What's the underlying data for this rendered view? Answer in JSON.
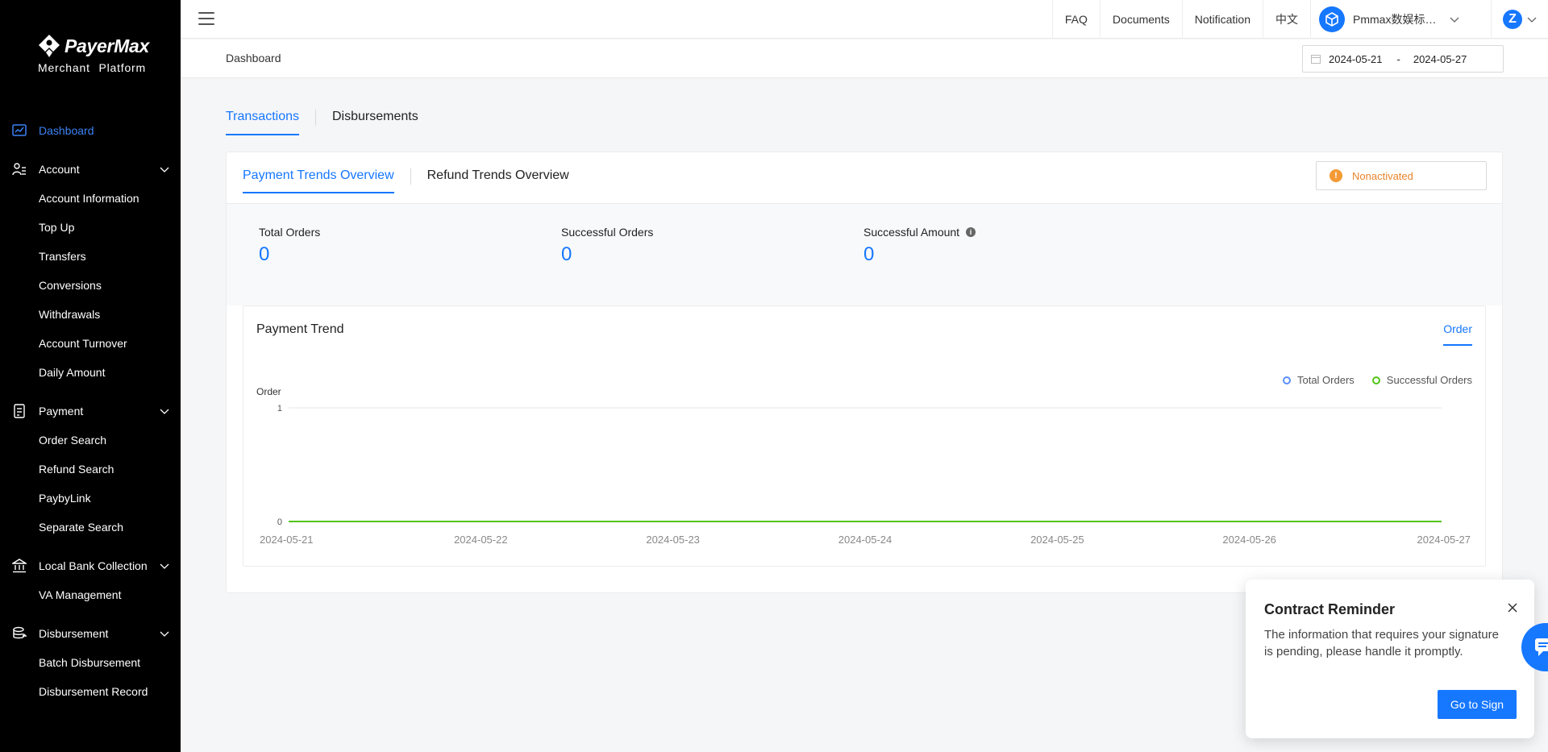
{
  "sidebar": {
    "logo_text": "PayerMax",
    "logo_subtext": "Merchant Platform",
    "dashboard": "Dashboard",
    "groups": [
      {
        "label": "Account",
        "items": [
          "Account Information",
          "Top Up",
          "Transfers",
          "Conversions",
          "Withdrawals",
          "Account Turnover",
          "Daily Amount"
        ]
      },
      {
        "label": "Payment",
        "items": [
          "Order Search",
          "Refund Search",
          "PaybyLink",
          "Separate Search"
        ]
      },
      {
        "label": "Local Bank Collection",
        "items": [
          "VA Management"
        ]
      },
      {
        "label": "Disbursement",
        "items": [
          "Batch Disbursement",
          "Disbursement Record"
        ]
      }
    ]
  },
  "header": {
    "links": [
      "FAQ",
      "Documents",
      "Notification",
      "中文"
    ],
    "merchant_name": "Pmmax数娱标准化测试商户",
    "avatar_letter": "Z"
  },
  "breadcrumb": "Dashboard",
  "date_range": {
    "start": "2024-05-21",
    "separator": "-",
    "end": "2024-05-27"
  },
  "main_tabs": [
    "Transactions",
    "Disbursements"
  ],
  "sub_tabs": [
    "Payment Trends Overview",
    "Refund Trends Overview"
  ],
  "status": "Nonactivated",
  "stats": [
    {
      "label": "Total Orders",
      "value": "0"
    },
    {
      "label": "Successful Orders",
      "value": "0"
    },
    {
      "label": "Successful Amount",
      "value": "0"
    }
  ],
  "trend": {
    "title": "Payment Trend",
    "tab": "Order"
  },
  "chart_data": {
    "type": "line",
    "ylabel": "Order",
    "ylim": [
      0,
      1
    ],
    "yticks": [
      "1",
      "0"
    ],
    "categories": [
      "2024-05-21",
      "2024-05-22",
      "2024-05-23",
      "2024-05-24",
      "2024-05-25",
      "2024-05-26",
      "2024-05-27"
    ],
    "series": [
      {
        "name": "Total Orders",
        "values": [
          0,
          0,
          0,
          0,
          0,
          0,
          0
        ],
        "color": "#5b8ff9"
      },
      {
        "name": "Successful Orders",
        "values": [
          0,
          0,
          0,
          0,
          0,
          0,
          0
        ],
        "color": "#52c41a"
      }
    ],
    "legend": "top-right",
    "grid": true
  },
  "popup": {
    "title": "Contract Reminder",
    "text": "The information that requires your signature is pending, please handle it promptly.",
    "button": "Go to Sign"
  },
  "colors": {
    "accent": "#1677ff",
    "warning": "#e8842b",
    "sidebar_bg": "#000000"
  }
}
